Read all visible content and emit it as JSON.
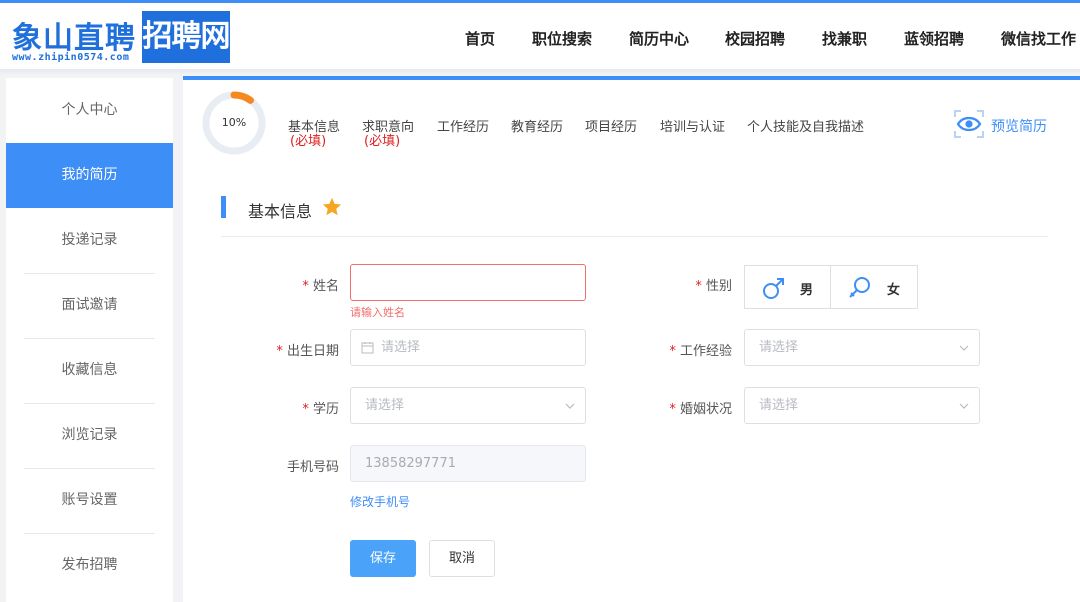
{
  "logo": {
    "main": "象山直聘",
    "boxed": "招聘网",
    "url": "www.zhipin0574.com"
  },
  "nav": [
    "首页",
    "职位搜索",
    "简历中心",
    "校园招聘",
    "找兼职",
    "蓝领招聘",
    "微信找工作"
  ],
  "sidebar": {
    "items": [
      "个人中心",
      "我的简历",
      "投递记录",
      "面试邀请",
      "收藏信息",
      "浏览记录",
      "账号设置",
      "发布招聘"
    ],
    "active_index": 1
  },
  "progress": {
    "label": "10%",
    "value": 0.1
  },
  "steps": [
    "基本信息",
    "求职意向",
    "工作经历",
    "教育经历",
    "项目经历",
    "培训与认证",
    "个人技能及自我描述"
  ],
  "required_tag": "(必填)",
  "preview": {
    "label": "预览简历",
    "icon": "eye-icon"
  },
  "section": {
    "title": "基本信息",
    "icon": "star-icon"
  },
  "form": {
    "required_mark": "*",
    "name": {
      "label": "姓名",
      "value": "",
      "error": "请输入姓名"
    },
    "gender": {
      "label": "性别",
      "male": "男",
      "female": "女",
      "male_icon": "male-symbol-icon",
      "female_icon": "female-symbol-icon"
    },
    "birth": {
      "label": "出生日期",
      "placeholder": "请选择",
      "icon": "calendar-icon"
    },
    "experience": {
      "label": "工作经验",
      "placeholder": "请选择"
    },
    "education": {
      "label": "学历",
      "placeholder": "请选择"
    },
    "marital": {
      "label": "婚姻状况",
      "placeholder": "请选择"
    },
    "phone": {
      "label": "手机号码",
      "value": "13858297771",
      "change_link": "修改手机号"
    }
  },
  "buttons": {
    "save": "保存",
    "cancel": "取消"
  },
  "colors": {
    "primary": "#3d8ef7",
    "error": "#f56c6c",
    "required": "#e02020",
    "progress": "#f5891f",
    "star": "#f5a623"
  }
}
